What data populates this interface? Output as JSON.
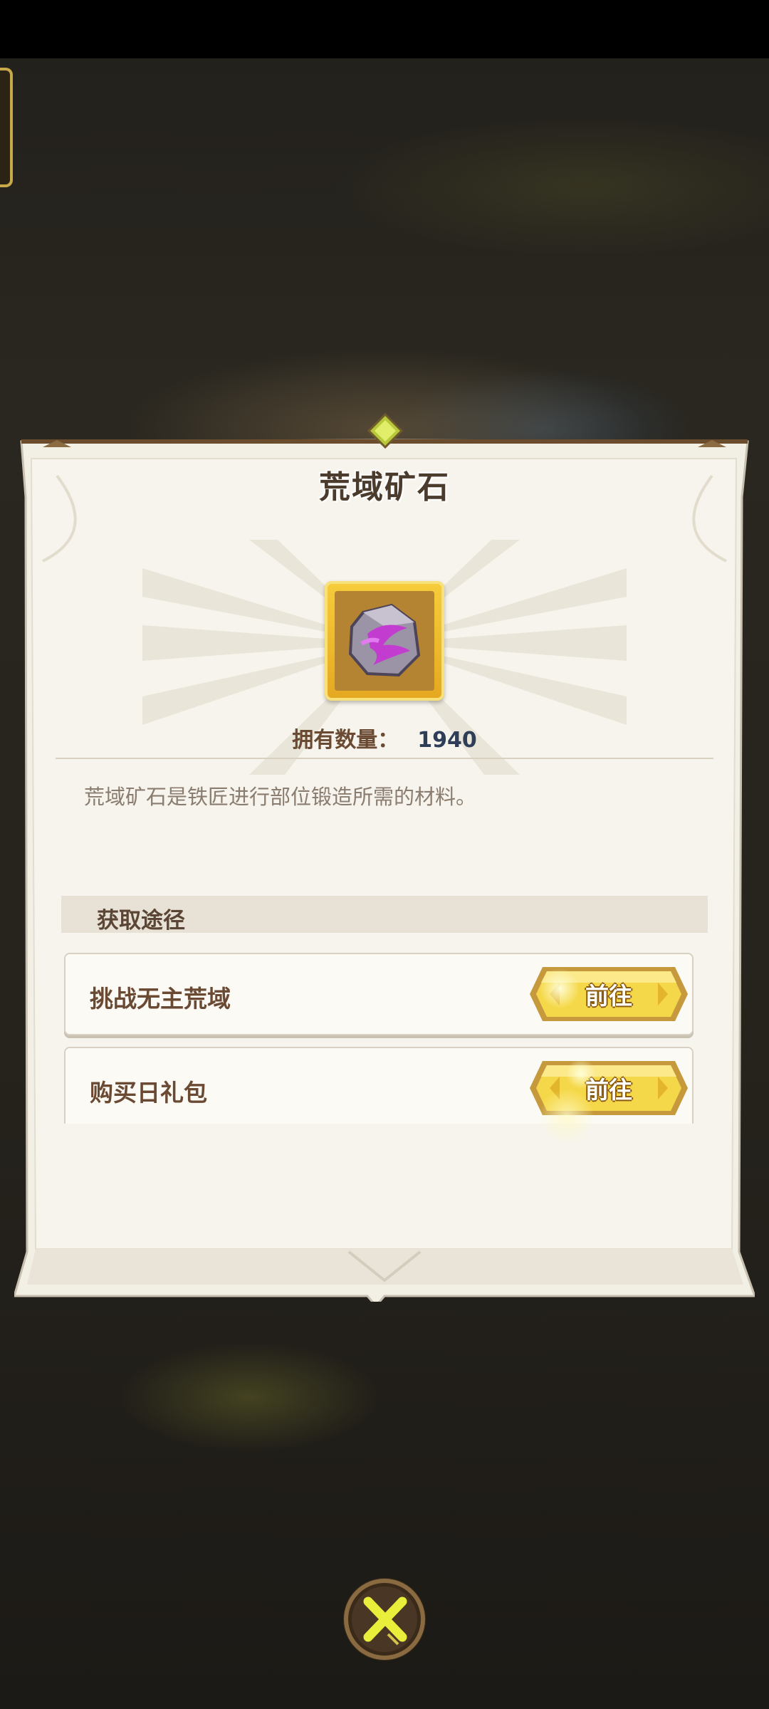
{
  "dialog": {
    "title": "荒域矿石",
    "owned_label": "拥有数量：",
    "owned_count": "1940",
    "description": "荒域矿石是铁匠进行部位锻造所需的材料。"
  },
  "item": {
    "icon": "purple-ore-icon"
  },
  "sources": {
    "header": "获取途径",
    "items": [
      {
        "label": "挑战无主荒域",
        "button": "前往"
      },
      {
        "label": "购买日礼包",
        "button": "前往"
      }
    ]
  },
  "close": {
    "icon": "close-x-icon"
  },
  "colors": {
    "panel": "#f3f0e6",
    "gold": "#f1c932",
    "title_text": "#4a3b2c",
    "count_text": "#2f3e58"
  }
}
